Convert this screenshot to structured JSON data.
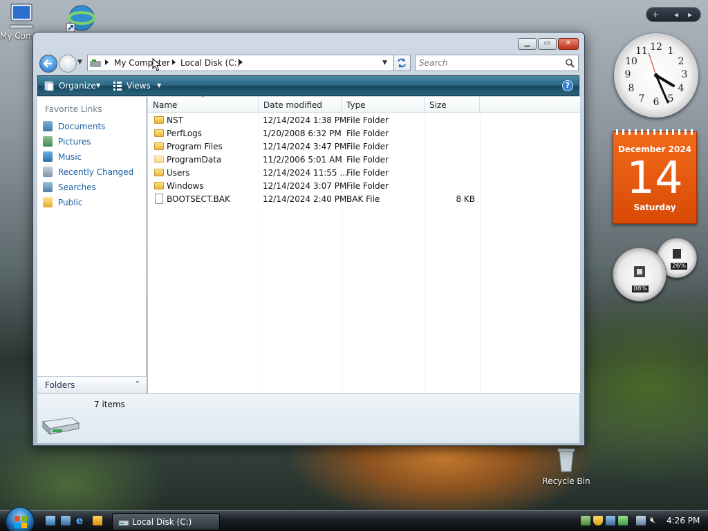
{
  "desktop": {
    "my_computer_label": "My Computer",
    "recycle_bin_label": "Recycle Bin"
  },
  "window": {
    "address": {
      "crumbs": [
        "My Computer",
        "Local Disk (C:)"
      ]
    },
    "search_placeholder": "Search",
    "toolbar": {
      "organize": "Organize",
      "views": "Views",
      "help": "?"
    },
    "sidebar": {
      "title": "Favorite Links",
      "links": [
        "Documents",
        "Pictures",
        "Music",
        "Recently Changed",
        "Searches",
        "Public"
      ],
      "folders_label": "Folders"
    },
    "columns": [
      "Name",
      "Date modified",
      "Type",
      "Size"
    ],
    "rows": [
      {
        "name": "NST",
        "date": "12/14/2024 1:38 PM",
        "type": "File Folder",
        "size": ""
      },
      {
        "name": "PerfLogs",
        "date": "1/20/2008 6:32 PM",
        "type": "File Folder",
        "size": ""
      },
      {
        "name": "Program Files",
        "date": "12/14/2024 3:47 PM",
        "type": "File Folder",
        "size": ""
      },
      {
        "name": "ProgramData",
        "date": "11/2/2006 5:01 AM",
        "type": "File Folder",
        "size": ""
      },
      {
        "name": "Users",
        "date": "12/14/2024 11:55 ...",
        "type": "File Folder",
        "size": ""
      },
      {
        "name": "Windows",
        "date": "12/14/2024 3:07 PM",
        "type": "File Folder",
        "size": ""
      },
      {
        "name": "BOOTSECT.BAK",
        "date": "12/14/2024 2:40 PM",
        "type": "BAK File",
        "size": "8 KB"
      }
    ],
    "status": "7 items"
  },
  "gadgets": {
    "calendar": {
      "month_year": "December 2024",
      "day": "14",
      "weekday": "Saturday"
    },
    "cpu_percent": "08%",
    "memory_percent": "26%",
    "clock_numbers": [
      "12",
      "1",
      "2",
      "3",
      "4",
      "5",
      "6",
      "7",
      "8",
      "9",
      "10",
      "11"
    ]
  },
  "taskbar": {
    "task_label": "Local Disk (C:)",
    "time": "4:26 PM"
  },
  "colors": {
    "link": "#1a5fa8",
    "toolbar": "#2a6480",
    "calendar": "#e85a0e"
  }
}
